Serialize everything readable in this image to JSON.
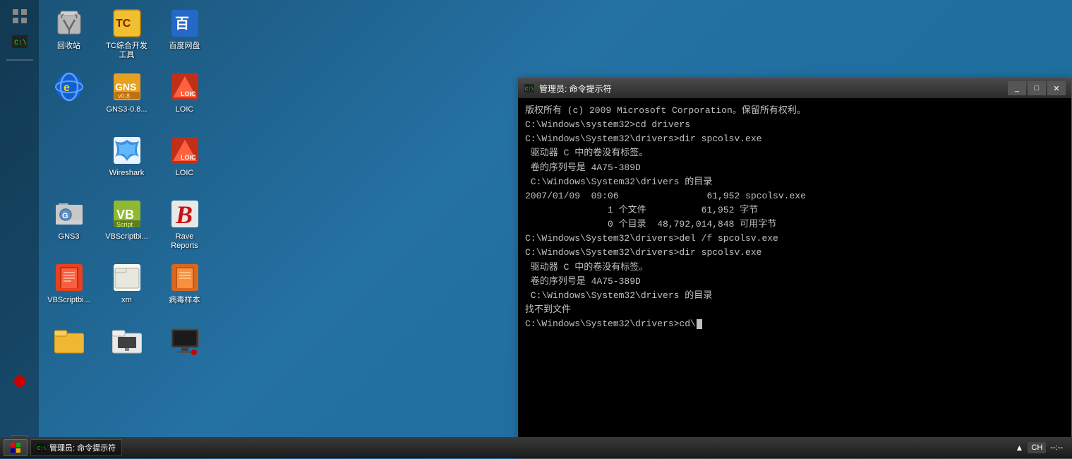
{
  "desktop": {
    "background_color": "#1a6b9a",
    "icons": [
      {
        "id": "recycle-bin",
        "label": "回收站",
        "row": 1,
        "col": 1,
        "type": "recycle"
      },
      {
        "id": "tc",
        "label": "TC综合开发\n工具",
        "row": 1,
        "col": 2,
        "type": "tc"
      },
      {
        "id": "baidu",
        "label": "百度网盘",
        "row": 1,
        "col": 3,
        "type": "baidu"
      },
      {
        "id": "ie",
        "label": "",
        "row": 2,
        "col": 1,
        "type": "ie"
      },
      {
        "id": "gns38",
        "label": "GNS3-0.8...",
        "row": 2,
        "col": 2,
        "type": "gns38"
      },
      {
        "id": "loic1",
        "label": "LOIC",
        "row": 2,
        "col": 3,
        "type": "loic"
      },
      {
        "id": "wireshark",
        "label": "Wireshark",
        "row": 3,
        "col": 2,
        "type": "wireshark"
      },
      {
        "id": "loic2",
        "label": "LOIC",
        "row": 3,
        "col": 3,
        "type": "loic"
      },
      {
        "id": "gns3",
        "label": "GNS3",
        "row": 4,
        "col": 1,
        "type": "gns3"
      },
      {
        "id": "vbsbi1",
        "label": "VBScriptbi...",
        "row": 4,
        "col": 2,
        "type": "vbs"
      },
      {
        "id": "rave",
        "label": "Rave\nReports",
        "row": 4,
        "col": 3,
        "type": "rave"
      },
      {
        "id": "vbsbi2",
        "label": "VBScriptbi...",
        "row": 5,
        "col": 1,
        "type": "vbs"
      },
      {
        "id": "xm",
        "label": "xm",
        "row": 5,
        "col": 2,
        "type": "xm"
      },
      {
        "id": "virus",
        "label": "病毒样本",
        "row": 5,
        "col": 3,
        "type": "virus"
      },
      {
        "id": "folder1",
        "label": "",
        "row": 6,
        "col": 1,
        "type": "folder"
      },
      {
        "id": "folder2",
        "label": "",
        "row": 6,
        "col": 2,
        "type": "folder2"
      },
      {
        "id": "monitor",
        "label": "",
        "row": 6,
        "col": 3,
        "type": "monitor"
      }
    ]
  },
  "taskbar": {
    "left_icons": [
      "grid",
      "terminal"
    ],
    "bottom_items": [
      {
        "label": "CH",
        "type": "lang"
      },
      {
        "label": "▲",
        "type": "systray"
      }
    ],
    "clock": "管理员: 命令提示符"
  },
  "cmd_window": {
    "title": "管理员: 命令提示符",
    "title_icon": "cmd",
    "controls": [
      "_",
      "□",
      "×"
    ],
    "content": [
      "版权所有 (c) 2009 Microsoft Corporation。保留所有权利。",
      "",
      "C:\\Windows\\system32>cd drivers",
      "",
      "C:\\Windows\\System32\\drivers>dir spcolsv.exe",
      " 驱动器 C 中的卷没有标签。",
      " 卷的序列号是 4A75-389D",
      "",
      " C:\\Windows\\System32\\drivers 的目录",
      "",
      "2007/01/09  09:06                61,952 spcolsv.exe",
      "               1 个文件          61,952 字节",
      "               0 个目录  48,792,014,848 可用字节",
      "",
      "C:\\Windows\\System32\\drivers>del /f spcolsv.exe",
      "",
      "C:\\Windows\\System32\\drivers>dir spcolsv.exe",
      " 驱动器 C 中的卷没有标签。",
      " 卷的序列号是 4A75-389D",
      "",
      " C:\\Windows\\System32\\drivers 的目录",
      "",
      "找不到文件",
      "",
      "C:\\Windows\\System32\\drivers>cd\\"
    ]
  }
}
